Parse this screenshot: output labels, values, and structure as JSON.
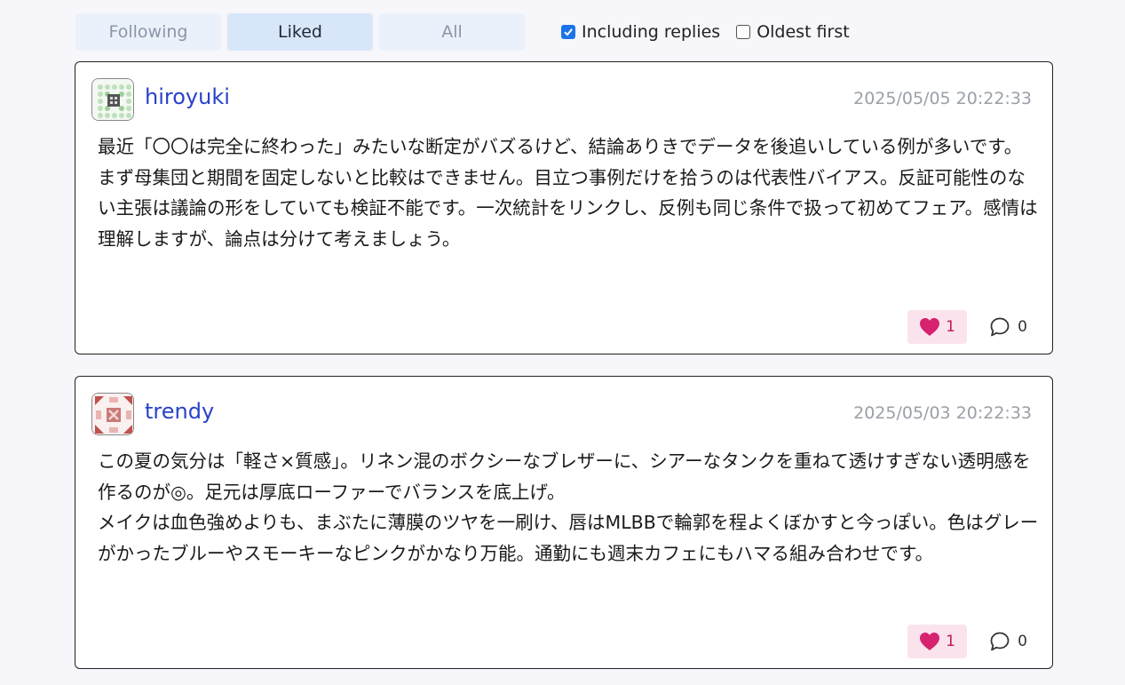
{
  "tabs": [
    {
      "label": "Following",
      "active": false
    },
    {
      "label": "Liked",
      "active": true
    },
    {
      "label": "All",
      "active": false
    }
  ],
  "options": {
    "including_replies": {
      "label": "Including replies",
      "checked": true
    },
    "oldest_first": {
      "label": "Oldest first",
      "checked": false
    }
  },
  "posts": [
    {
      "username": "hiroyuki",
      "date": "2025/05/05 20:22:33",
      "avatar_color": "#7ab87a",
      "paragraphs": [
        "最近「〇〇は完全に終わった」みたいな断定がバズるけど、結論ありきでデータを後追いしている例が多いです。",
        "まず母集団と期間を固定しないと比較はできません。目立つ事例だけを拾うのは代表性バイアス。反証可能性のない主張は議論の形をしていても検証不能です。一次統計をリンクし、反例も同じ条件で扱って初めてフェア。感情は理解しますが、論点は分けて考えましょう。"
      ],
      "likes": "1",
      "replies": "0",
      "liked": true
    },
    {
      "username": "trendy",
      "date": "2025/05/03 20:22:33",
      "avatar_color": "#c0504d",
      "paragraphs": [
        "この夏の気分は「軽さ×質感」。リネン混のボクシーなブレザーに、シアーなタンクを重ねて透けすぎない透明感を作るのが◎。足元は厚底ローファーでバランスを底上げ。",
        "メイクは血色強めよりも、まぶたに薄膜のツヤを一刷け、唇はMLBBで輪郭を程よくぼかすと今っぽい。色はグレーがかったブルーやスモーキーなピンクがかなり万能。通勤にも週末カフェにもハマる組み合わせです。"
      ],
      "likes": "1",
      "replies": "0",
      "liked": true
    }
  ],
  "colors": {
    "accent": "#1a73e8",
    "username": "#2942c8",
    "like": "#d6226f",
    "like_bg": "#fbe3ee"
  },
  "icons": {
    "like": "heart-icon",
    "reply": "speech-bubble-icon",
    "avatar": "identicon"
  }
}
